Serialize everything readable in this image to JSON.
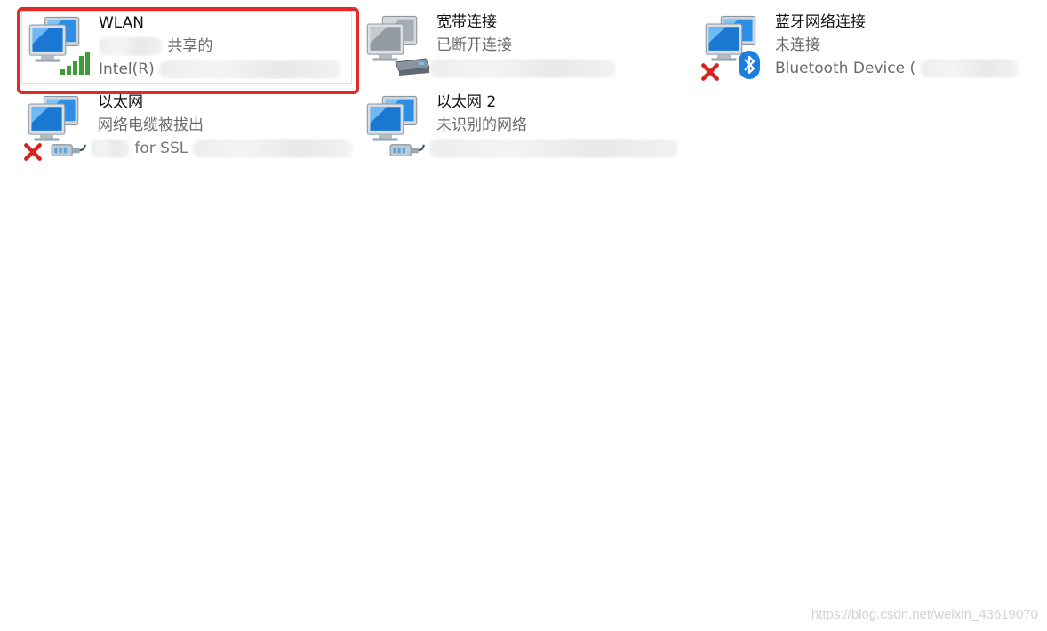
{
  "connections": [
    {
      "name": "WLAN",
      "status_suffix": "共享的",
      "device_prefix": "Intel(R)",
      "signal_icon": "wifi-signal-icon",
      "selected": true
    },
    {
      "name": "宽带连接",
      "status": "已断开连接",
      "device_icon": "modem-icon"
    },
    {
      "name": "蓝牙网络连接",
      "status": "未连接",
      "device_prefix": "Bluetooth Device (",
      "device_icon": "bluetooth-icon",
      "error_icon": "red-x-icon"
    },
    {
      "name": "以太网",
      "status": "网络电缆被拔出",
      "device_fragment": "for SSL",
      "device_icon": "ethernet-icon",
      "error_icon": "red-x-icon"
    },
    {
      "name": "以太网 2",
      "status": "未识别的网络",
      "device_icon": "ethernet-icon"
    }
  ],
  "watermark": "https://blog.csdn.net/weixin_43619070",
  "colors": {
    "highlight": "#e22926",
    "monitor_blue": "#1a78d2",
    "signal_green": "#3f9a3a",
    "bluetooth": "#1b7fe0",
    "error_red": "#d9201c"
  }
}
